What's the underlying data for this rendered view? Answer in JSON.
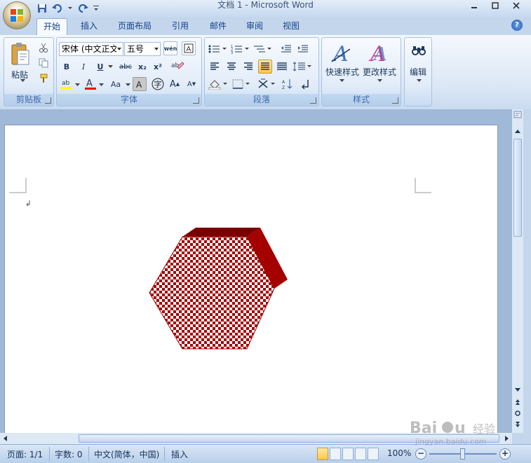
{
  "window": {
    "title": "文档 1 - Microsoft Word",
    "controls": [
      "minimize",
      "maximize",
      "close"
    ]
  },
  "qat": {
    "save_icon": "save-icon",
    "undo_icon": "undo-icon",
    "redo_icon": "redo-icon"
  },
  "tabs": [
    {
      "label": "开始",
      "active": true
    },
    {
      "label": "插入"
    },
    {
      "label": "页面布局"
    },
    {
      "label": "引用"
    },
    {
      "label": "邮件"
    },
    {
      "label": "审阅"
    },
    {
      "label": "视图"
    }
  ],
  "ribbon": {
    "clipboard": {
      "label": "剪贴板",
      "paste": "粘贴"
    },
    "font": {
      "label": "字体",
      "font_name": "宋体 (中文正文",
      "font_size": "五号",
      "bold": "B",
      "italic": "I",
      "underline": "U",
      "strike": "abc",
      "sub": "x₂",
      "sup": "x²",
      "wen": "wén",
      "grow": "A",
      "shrink": "A",
      "case": "Aa"
    },
    "paragraph": {
      "label": "段落"
    },
    "styles": {
      "label": "样式",
      "quick": "快速样式",
      "change": "更改样式"
    },
    "editing": {
      "label": "编辑"
    }
  },
  "document": {
    "shape": {
      "type": "hexagon",
      "fill": "checkerboard",
      "color": "#a40000"
    }
  },
  "status": {
    "page": "页面: 1/1",
    "words": "字数: 0",
    "language": "中文(简体，中国)",
    "mode": "插入",
    "zoom": "100%"
  },
  "watermark": {
    "brand": "Baidu",
    "sub": "jingyan.baidu.com",
    "cn": "经验"
  }
}
